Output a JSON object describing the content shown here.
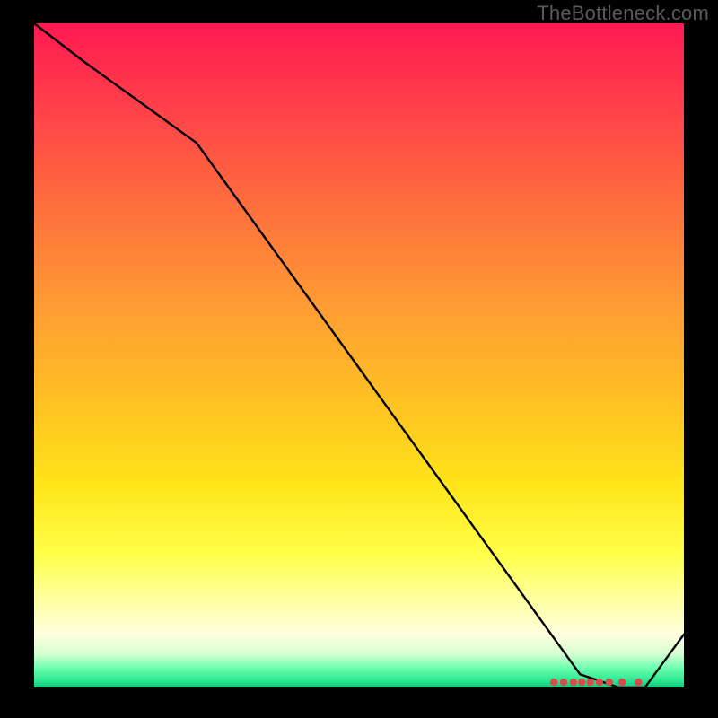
{
  "watermark": "TheBottleneck.com",
  "colors": {
    "background": "#000000",
    "line": "#000000",
    "marker": "#d94a4a",
    "watermark": "#5a5a5a"
  },
  "chart_data": {
    "type": "line",
    "title": "",
    "xlabel": "",
    "ylabel": "",
    "xlim": [
      0,
      100
    ],
    "ylim": [
      0,
      100
    ],
    "series": [
      {
        "name": "curve",
        "x": [
          0,
          8,
          25,
          84,
          90,
          94,
          100
        ],
        "y": [
          100,
          94,
          82,
          2,
          0,
          0,
          8
        ]
      }
    ],
    "markers": {
      "name": "cluster",
      "points": [
        {
          "x": 80.0,
          "y": 0.8
        },
        {
          "x": 81.5,
          "y": 0.8
        },
        {
          "x": 83.0,
          "y": 0.8
        },
        {
          "x": 84.3,
          "y": 0.8
        },
        {
          "x": 85.6,
          "y": 0.8
        },
        {
          "x": 87.0,
          "y": 0.8
        },
        {
          "x": 88.5,
          "y": 0.8
        },
        {
          "x": 90.5,
          "y": 0.8
        },
        {
          "x": 93.0,
          "y": 0.8
        }
      ]
    }
  }
}
